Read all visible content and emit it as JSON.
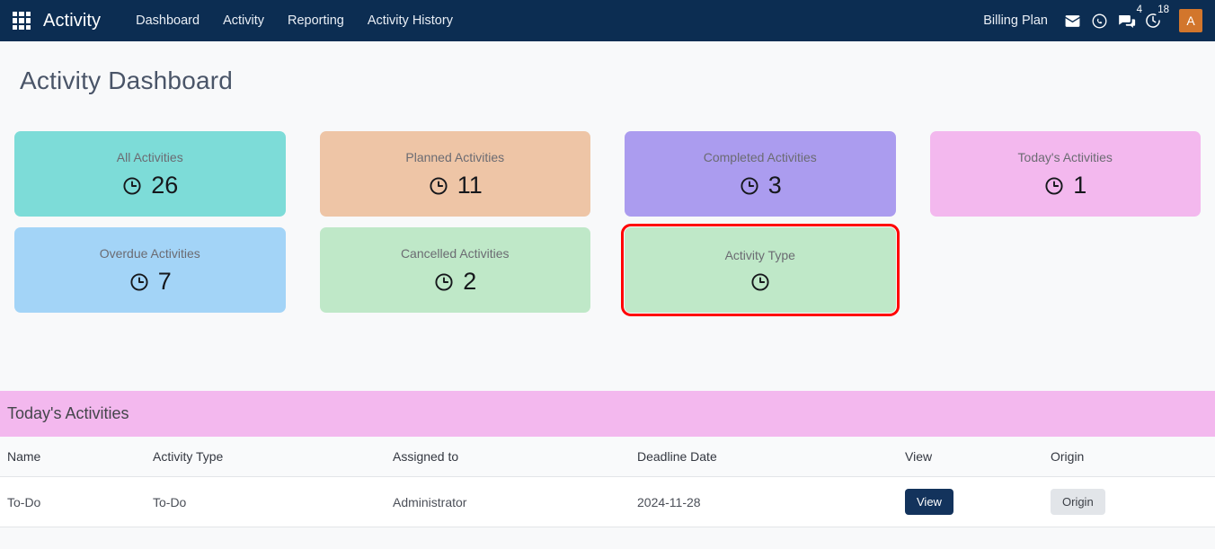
{
  "navbar": {
    "apps_icon": "apps-grid-icon",
    "brand": "Activity",
    "links": [
      {
        "label": "Dashboard"
      },
      {
        "label": "Activity"
      },
      {
        "label": "Reporting"
      },
      {
        "label": "Activity History"
      }
    ],
    "billing_plan": "Billing Plan",
    "icons": [
      {
        "name": "mail-icon",
        "badge": ""
      },
      {
        "name": "whatsapp-icon",
        "badge": ""
      },
      {
        "name": "messages-icon",
        "badge": "4"
      },
      {
        "name": "activity-clock-icon",
        "badge": "18"
      }
    ],
    "avatar": "A",
    "bg_color": "#0c2d52",
    "avatar_color": "#d2762c"
  },
  "page": {
    "title": "Activity Dashboard",
    "bg_color": "#f8f9fa"
  },
  "cards": [
    {
      "title": "All Activities",
      "value": "26",
      "color": "#7ddcd8",
      "icon": "clock-icon",
      "selected": false
    },
    {
      "title": "Planned Activities",
      "value": "11",
      "color": "#eec5a6",
      "icon": "clock-icon",
      "selected": false
    },
    {
      "title": "Completed Activities",
      "value": "3",
      "color": "#ab9cef",
      "icon": "clock-icon",
      "selected": false
    },
    {
      "title": "Today's Activities",
      "value": "1",
      "color": "#f3b8ee",
      "icon": "clock-icon",
      "selected": false
    },
    {
      "title": "Overdue Activities",
      "value": "7",
      "color": "#a3d4f7",
      "icon": "clock-icon",
      "selected": false
    },
    {
      "title": "Cancelled Activities",
      "value": "2",
      "color": "#bfe8c8",
      "icon": "clock-icon",
      "selected": false
    },
    {
      "title": "Activity Type",
      "value": "",
      "color": "#bfe8c8",
      "icon": "clock-icon",
      "selected": true
    }
  ],
  "selection_color": "#ff0000",
  "table": {
    "heading": "Today's Activities",
    "heading_bg": "#f3b8ee",
    "columns": [
      "Name",
      "Activity Type",
      "Assigned to",
      "Deadline Date",
      "View",
      "Origin"
    ],
    "rows": [
      {
        "name": "To-Do",
        "activity_type": "To-Do",
        "assigned_to": "Administrator",
        "deadline_date": "2024-11-28",
        "view_label": "View",
        "origin_label": "Origin"
      }
    ]
  }
}
